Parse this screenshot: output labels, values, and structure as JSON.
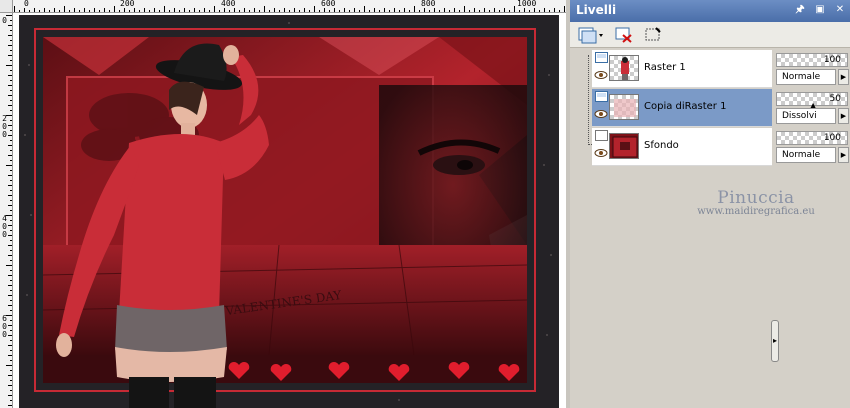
{
  "ruler": {
    "top_labels": [
      "0",
      "200",
      "400",
      "600",
      "800",
      "1000"
    ],
    "left_labels": [
      "0",
      "200",
      "400",
      "600"
    ]
  },
  "canvas": {
    "image_text": "VALENTINE'S DAY",
    "accent_colors": [
      "#8e1820",
      "#c72a35",
      "#242226"
    ]
  },
  "panel": {
    "title": "Livelli",
    "title_buttons": [
      "pin-icon",
      "minimize-icon",
      "close-icon"
    ],
    "toolbar": [
      "new-layer-icon",
      "delete-layer-icon",
      "mask-icon"
    ],
    "layers": [
      {
        "name": "Raster 1",
        "opacity": "100",
        "blend": "Normale",
        "selected": false
      },
      {
        "name": "Copia diRaster 1",
        "opacity": "50",
        "blend": "Dissolvi",
        "selected": true
      },
      {
        "name": "Sfondo",
        "opacity": "100",
        "blend": "Normale",
        "selected": false
      }
    ],
    "splitter_arrow": "▸"
  },
  "watermark": {
    "name": "Pinuccia",
    "url": "www.maidiregrafica.eu"
  }
}
